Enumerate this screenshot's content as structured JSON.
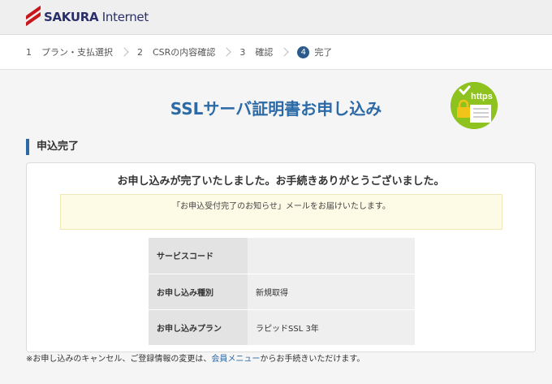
{
  "brand": {
    "name_bold": "SAKURA",
    "name_light": " Internet"
  },
  "steps": [
    {
      "num": "1",
      "label": "プラン・支払選択",
      "active": false
    },
    {
      "num": "2",
      "label": "CSRの内容確認",
      "active": false
    },
    {
      "num": "3",
      "label": "確認",
      "active": false
    },
    {
      "num": "4",
      "label": "完了",
      "active": true
    }
  ],
  "page_title": "SSLサーバ証明書お申し込み",
  "badge": {
    "text": "https",
    "color": "#8dc21f"
  },
  "section_heading": "申込完了",
  "completion": {
    "message": "お申し込みが完了いたしました。お手続きありがとうございました。",
    "notice": "「お申込受付完了のお知らせ」メールをお届けいたします。"
  },
  "details": [
    {
      "label": "サービスコード",
      "value": ""
    },
    {
      "label": "お申し込み種別",
      "value": "新規取得"
    },
    {
      "label": "お申し込みプラン",
      "value": "ラピッドSSL 3年"
    }
  ],
  "footer": {
    "before": "※お申し込みのキャンセル、ご登録情報の変更は、",
    "link": "会員メニュー",
    "after": "からお手続きいただけます。"
  },
  "colors": {
    "accent": "#2b6aa6",
    "brand_red": "#c8161d",
    "notice_bg": "#fdfae6"
  }
}
